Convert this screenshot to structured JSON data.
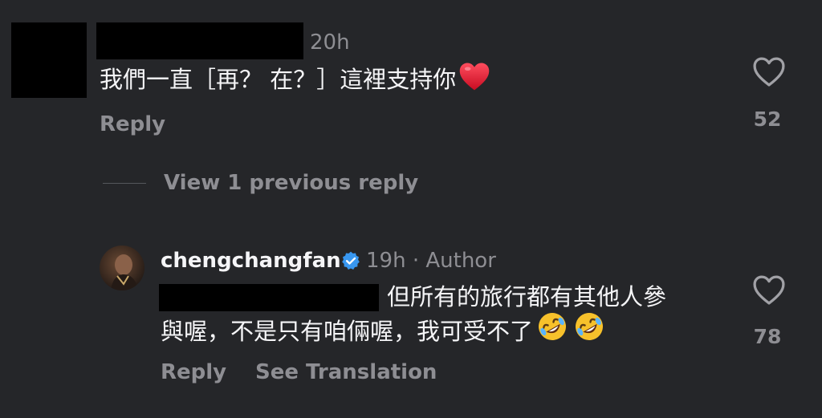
{
  "comment1": {
    "time": "20h",
    "text": "我們一直［再？ 在？］這裡支持你",
    "reply_label": "Reply",
    "like_count": "52"
  },
  "thread": {
    "view_previous_label": "View 1 previous reply"
  },
  "reply1": {
    "username": "chengchangfan",
    "verified_icon": "verified-badge-icon",
    "time": "19h",
    "separator": "·",
    "author_tag": "Author",
    "text_line1": "但所有的旅行都有其他人參",
    "text_line2": "與喔，不是只有咱倆喔，我可受不了",
    "emojis": [
      "🤣",
      "🤣"
    ],
    "reply_label": "Reply",
    "see_translation_label": "See Translation",
    "like_count": "78"
  },
  "colors": {
    "background": "#252629",
    "primary_text": "#f5f5f7",
    "secondary_text": "#8e8e93",
    "verified_blue": "#3897f0",
    "heart_red": "#e8112d"
  }
}
